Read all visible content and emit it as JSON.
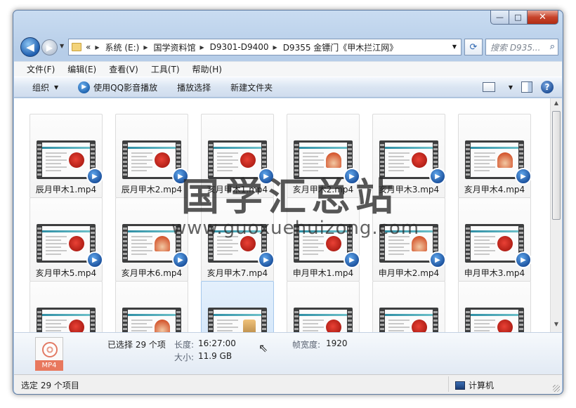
{
  "window": {
    "controls": {
      "minimize": "—",
      "maximize": "□",
      "close": "✕"
    }
  },
  "nav": {
    "back": "◀",
    "forward": "▶",
    "breadcrumb_overflow": "«",
    "breadcrumbs": [
      "系统 (E:)",
      "国学资料馆",
      "D9301-D9400",
      "D9355 金镖门《甲木拦江网》"
    ],
    "refresh": "⟳",
    "search_placeholder": "搜索 D935..."
  },
  "menu": [
    "文件(F)",
    "编辑(E)",
    "查看(V)",
    "工具(T)",
    "帮助(H)"
  ],
  "toolbar": {
    "organize": "组织",
    "qq_play": "使用QQ影音播放",
    "play_selection": "播放选择",
    "new_folder": "新建文件夹",
    "help": "?"
  },
  "files": [
    {
      "name": "辰月甲木1.mp4",
      "art": "red"
    },
    {
      "name": "辰月甲木2.mp4",
      "art": "red"
    },
    {
      "name": "亥月甲木1.mp4",
      "art": "red"
    },
    {
      "name": "亥月甲木2.mp4",
      "art": "fan"
    },
    {
      "name": "亥月甲木3.mp4",
      "art": "red"
    },
    {
      "name": "亥月甲木4.mp4",
      "art": "fan"
    },
    {
      "name": "亥月甲木5.mp4",
      "art": "red"
    },
    {
      "name": "亥月甲木6.mp4",
      "art": "fan"
    },
    {
      "name": "亥月甲木7.mp4",
      "art": "red"
    },
    {
      "name": "申月甲木1.mp4",
      "art": "red"
    },
    {
      "name": "申月甲木2.mp4",
      "art": "fan"
    },
    {
      "name": "申月甲木3.mp4",
      "art": "red"
    },
    {
      "name": "",
      "art": "red"
    },
    {
      "name": "",
      "art": "fan"
    },
    {
      "name": "",
      "art": "tower",
      "selected": true
    },
    {
      "name": "",
      "art": "red"
    },
    {
      "name": "",
      "art": "red"
    },
    {
      "name": "",
      "art": "red"
    }
  ],
  "details": {
    "file_type": "MP4",
    "selected_count": "已选择 29 个项",
    "length_label": "长度:",
    "length_value": "16:27:00",
    "size_label": "大小:",
    "size_value": "11.9 GB",
    "frame_width_label": "帧宽度:",
    "frame_width_value": "1920"
  },
  "status": {
    "left": "选定 29 个项目",
    "right": "计算机"
  },
  "watermark": {
    "title": "国学汇总站",
    "url": "www.guoxuehuizong.com"
  },
  "colors": {
    "accent": "#1f5fb0",
    "selection": "#cfe3f8"
  }
}
